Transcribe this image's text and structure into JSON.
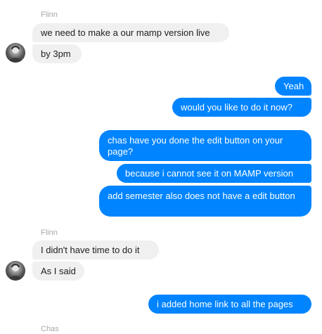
{
  "conversation": {
    "group1": {
      "sender": "Flinn",
      "messages": [
        "we need to make a our mamp version live",
        "by 3pm"
      ]
    },
    "group2": {
      "messages": [
        "Yeah",
        "would you like to do it now?"
      ]
    },
    "group3": {
      "messages": [
        "chas have you done the edit button on your page?",
        "because i cannot see it on MAMP version",
        "add semester also does not have a edit button"
      ]
    },
    "group4": {
      "sender": "Flinn",
      "messages": [
        "I didn't have time to do it",
        "As I said"
      ]
    },
    "group5": {
      "messages": [
        "i added home link to all the pages"
      ]
    },
    "group6": {
      "sender": "Chas"
    }
  },
  "colors": {
    "outgoing": "#0084ff",
    "incoming": "#f0f0f0",
    "sender_name": "#a7a7a7"
  },
  "icons": {
    "avatar": "user-avatar-photo"
  }
}
